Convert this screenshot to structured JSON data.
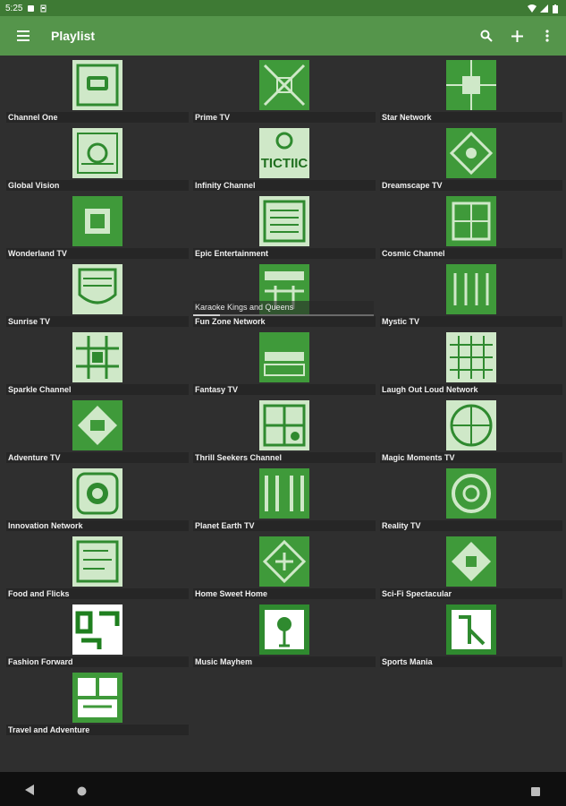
{
  "status_bar": {
    "time": "5:25"
  },
  "app_bar": {
    "title": "Playlist",
    "menu_icon": "hamburger-menu-icon",
    "actions": [
      "search-icon",
      "add-icon",
      "more-vert-icon"
    ]
  },
  "colors": {
    "status_bar": "#3e7a34",
    "app_bar": "#55954b",
    "background": "#2f2f2f",
    "thumb_green": "#3f9a3a",
    "nav_bar": "#0f0f0f"
  },
  "now_playing": {
    "text": "Karaoke Kings and Queens",
    "progress_fraction": 0.15
  },
  "channels": [
    {
      "label": "Channel One"
    },
    {
      "label": "Prime TV"
    },
    {
      "label": "Star Network"
    },
    {
      "label": "Global Vision"
    },
    {
      "label": "Infinity Channel"
    },
    {
      "label": "Dreamscape TV"
    },
    {
      "label": "Wonderland TV"
    },
    {
      "label": "Epic Entertainment"
    },
    {
      "label": "Cosmic Channel"
    },
    {
      "label": "Sunrise TV"
    },
    {
      "label": "Fun Zone Network"
    },
    {
      "label": "Mystic TV"
    },
    {
      "label": "Sparkle Channel"
    },
    {
      "label": "Fantasy TV"
    },
    {
      "label": "Laugh Out Loud Network"
    },
    {
      "label": "Adventure TV"
    },
    {
      "label": "Thrill Seekers Channel"
    },
    {
      "label": "Magic Moments TV"
    },
    {
      "label": "Innovation Network"
    },
    {
      "label": "Planet Earth TV"
    },
    {
      "label": "Reality TV"
    },
    {
      "label": "Food and Flicks"
    },
    {
      "label": "Home Sweet Home"
    },
    {
      "label": "Sci-Fi Spectacular"
    },
    {
      "label": "Fashion Forward"
    },
    {
      "label": "Music Mayhem"
    },
    {
      "label": "Sports Mania"
    },
    {
      "label": "Travel and Adventure"
    }
  ],
  "nav": [
    "back-icon",
    "home-icon",
    "recents-icon"
  ]
}
